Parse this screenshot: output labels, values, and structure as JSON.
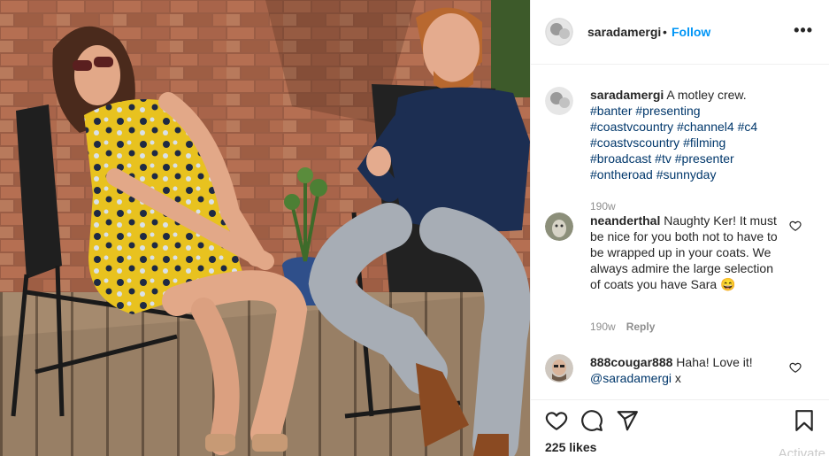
{
  "post": {
    "username": "saradamergi",
    "separator": "•",
    "follow_label": "Follow",
    "more_label": "•••"
  },
  "caption": {
    "username": "saradamergi",
    "text": "A motley crew.",
    "hashtags": [
      "#banter",
      "#presenting",
      "#coastvcountry",
      "#channel4",
      "#c4",
      "#coastvscountry",
      "#filming",
      "#broadcast",
      "#tv",
      "#presenter",
      "#ontheroad",
      "#sunnyday"
    ],
    "time": "190w"
  },
  "comments": [
    {
      "username": "neanderthal",
      "text": "Naughty Ker! It must be nice for you both not to have to be wrapped up in your coats. We always admire the large selection of coats you have Sara",
      "emoji": "😄",
      "time": "190w",
      "reply_label": "Reply"
    },
    {
      "username": "888cougar888",
      "text": "Haha! Love it!",
      "mention": "@saradamergi",
      "trailing": "x"
    }
  ],
  "footer": {
    "likes": "225 likes",
    "watermark": "Activate"
  },
  "icons": {
    "like": "heart-icon",
    "comment": "comment-bubble-icon",
    "share": "paper-plane-icon",
    "save": "bookmark-icon"
  },
  "colors": {
    "link_blue": "#0095f6",
    "hashtag": "#00376b",
    "muted": "#8e8e8e",
    "text": "#262626"
  }
}
